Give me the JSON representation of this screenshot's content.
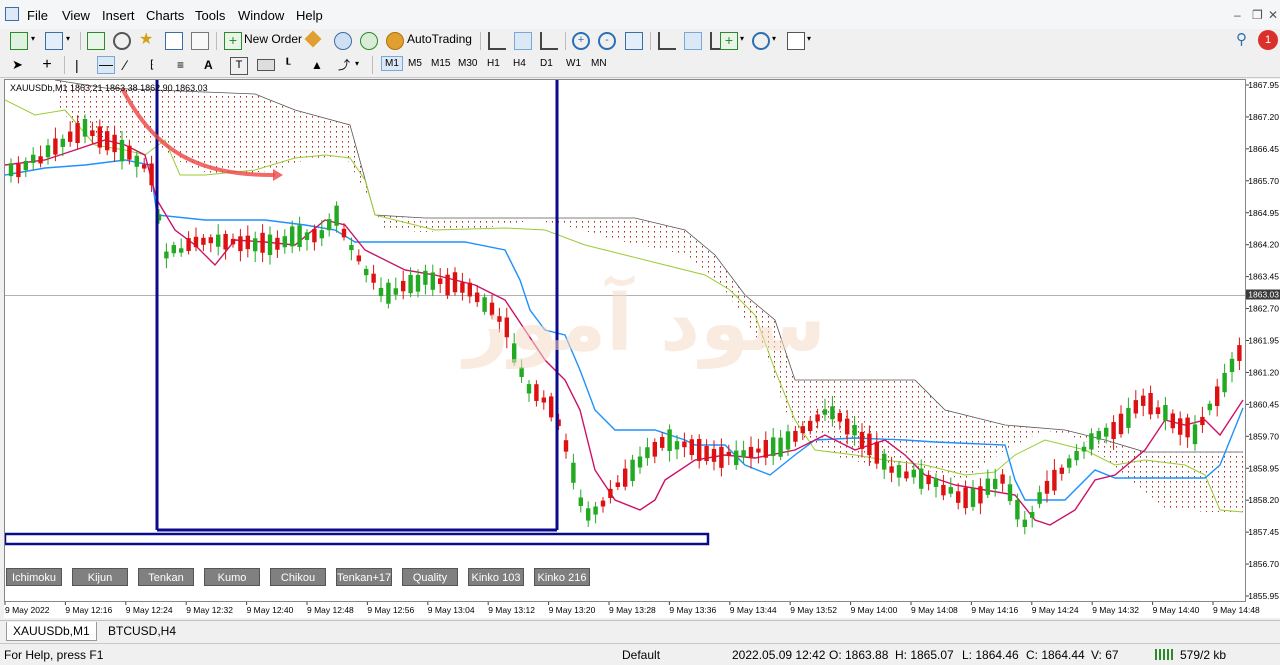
{
  "menu": {
    "items": [
      "File",
      "View",
      "Insert",
      "Charts",
      "Tools",
      "Window",
      "Help"
    ]
  },
  "toolbar": {
    "new_order": "New Order",
    "auto_trading": "AutoTrading",
    "timeframes": [
      "M1",
      "M5",
      "M15",
      "M30",
      "H1",
      "H4",
      "D1",
      "W1",
      "MN"
    ],
    "alert_count": "1"
  },
  "chart": {
    "header": "XAUUSDb,M1  1863.21 1863.38 1862.90 1863.03",
    "current_price": "1863.03",
    "price_labels": [
      "1867.95",
      "1867.20",
      "1866.45",
      "1865.70",
      "1864.95",
      "1864.20",
      "1863.45",
      "1862.70",
      "1861.95",
      "1861.20",
      "1860.45",
      "1859.70",
      "1858.95",
      "1858.20",
      "1857.45",
      "1856.70",
      "1855.95"
    ],
    "time_labels": [
      "9 May 2022",
      "9 May 12:16",
      "9 May 12:24",
      "9 May 12:32",
      "9 May 12:40",
      "9 May 12:48",
      "9 May 12:56",
      "9 May 13:04",
      "9 May 13:12",
      "9 May 13:20",
      "9 May 13:28",
      "9 May 13:36",
      "9 May 13:44",
      "9 May 13:52",
      "9 May 14:00",
      "9 May 14:08",
      "9 May 14:16",
      "9 May 14:24",
      "9 May 14:32",
      "9 May 14:40",
      "9 May 14:48"
    ],
    "indicator_buttons": [
      "Ichimoku",
      "Kijun",
      "Tenkan",
      "Kumo",
      "Chikou",
      "Tenkan+17",
      "Quality",
      "Kinko 103",
      "Kinko 216"
    ],
    "watermark": "سود آموز",
    "colors": {
      "bull": "#22aa22",
      "bear": "#dd1111",
      "kijun": "#1e90ff",
      "tenkan": "#cc1166",
      "chikou": "#99cc33",
      "cloud_dots": "#aa3322",
      "boxes": "#0a0a8c",
      "arrow": "#ee4444"
    }
  },
  "tabs": [
    "XAUUSDb,M1",
    "BTCUSD,H4"
  ],
  "status": {
    "help": "For Help, press F1",
    "profile": "Default",
    "datetime": "2022.05.09 12:42",
    "open": "O: 1863.88",
    "high": "H: 1865.07",
    "low": "L: 1864.46",
    "close": "C: 1864.44",
    "volume": "V: 67",
    "traffic": "579/2 kb"
  }
}
